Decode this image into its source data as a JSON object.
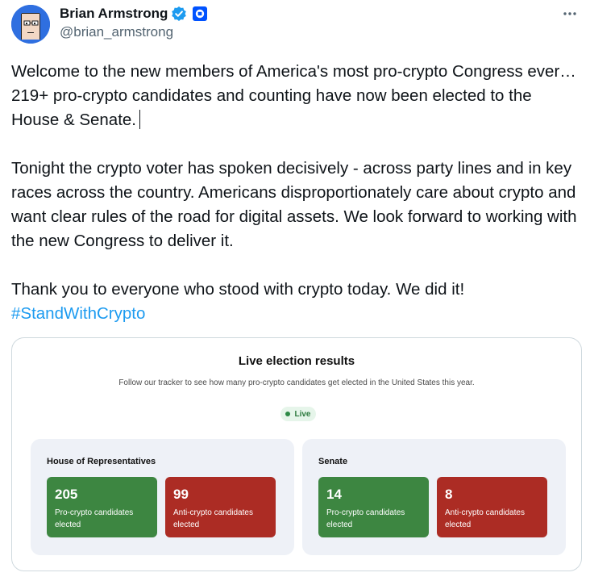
{
  "author": {
    "name": "Brian Armstrong",
    "handle": "@brian_armstrong",
    "verified_color": "#1d9bf0",
    "brand_color": "#0052ff"
  },
  "tweet": {
    "paragraph1": "Welcome to the new members of America's most pro-crypto Congress ever… 219+ pro-crypto candidates and counting have now been elected to the House & Senate.",
    "paragraph2": "Tonight the crypto voter has spoken decisively - across party lines and in key races across the country. Americans disproportionately care about crypto and want clear rules of the road for digital assets. We look forward to working with the new Congress to deliver it.",
    "paragraph3": "Thank you to everyone who stood with crypto today. We did it!",
    "hashtag": "#StandWithCrypto"
  },
  "card": {
    "title": "Live election results",
    "subtitle": "Follow our tracker to see how many pro-crypto candidates get elected in the United States this year.",
    "live_label": "Live",
    "house": {
      "title": "House of Representatives",
      "pro_count": "205",
      "pro_label": "Pro-crypto candidates elected",
      "anti_count": "99",
      "anti_label": "Anti-crypto candidates elected"
    },
    "senate": {
      "title": "Senate",
      "pro_count": "14",
      "pro_label": "Pro-crypto candidates elected",
      "anti_count": "8",
      "anti_label": "Anti-crypto candidates elected"
    },
    "colors": {
      "pro": "#3d8641",
      "anti": "#ac2c24",
      "live": "#2d8a46"
    }
  },
  "icons": {
    "avatar": "pixel-avatar-icon",
    "verified": "verified-badge-icon",
    "brand": "coinbase-logo-icon",
    "more": "more-options-icon"
  }
}
